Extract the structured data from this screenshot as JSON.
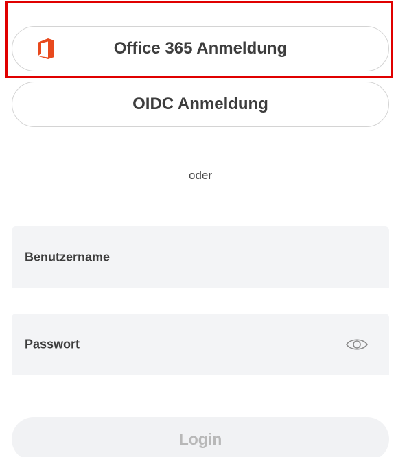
{
  "sso": {
    "office_label": "Office 365 Anmeldung",
    "office_icon": "office-365-icon",
    "office_icon_color": "#e8491d",
    "oidc_label": "OIDC Anmeldung"
  },
  "divider": {
    "text": "oder"
  },
  "form": {
    "username_label": "Benutzername",
    "password_label": "Passwort",
    "password_toggle_icon": "eye-icon"
  },
  "login": {
    "label": "Login"
  },
  "colors": {
    "highlight": "#e00000",
    "field_bg": "#f3f4f6",
    "login_disabled_bg": "#f1f2f4",
    "login_disabled_text": "#b8b8b8"
  }
}
